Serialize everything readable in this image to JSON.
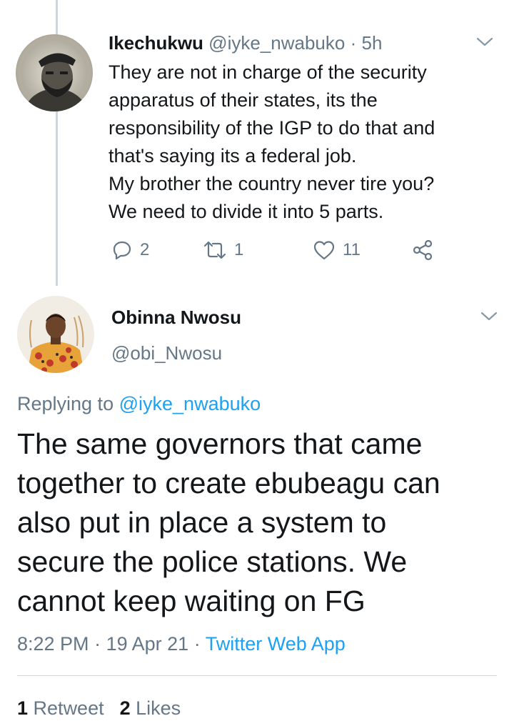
{
  "parent_tweet": {
    "name": "Ikechukwu",
    "handle": "@iyke_nwabuko",
    "separator": "·",
    "time": "5h",
    "text_lines": [
      "They are not in charge of the security",
      "apparatus of their states, its the",
      "responsibility of the IGP to do that and",
      "that's saying its a federal job.",
      "My brother the country never tire you?",
      "We need to divide it into 5 parts."
    ],
    "actions": {
      "replies": "2",
      "retweets": "1",
      "likes": "11"
    },
    "avatar_icon": "user-avatar-icon",
    "menu_icon": "chevron-down-icon"
  },
  "main_tweet": {
    "name": "Obinna Nwosu",
    "handle": "@obi_Nwosu",
    "replying_prefix": "Replying to",
    "replying_mention": "@iyke_nwabuko",
    "text_lines": [
      "The same governors that came",
      "together to create ebubeagu can",
      "also put in place a system to",
      "secure the police stations. We",
      "cannot keep waiting on FG"
    ],
    "time": "8:22 PM",
    "sep1": "·",
    "date": "19 Apr 21",
    "sep2": "·",
    "source": "Twitter Web App",
    "stats": {
      "retweet_count": "1",
      "retweet_label": "Retweet",
      "like_count": "2",
      "like_label": "Likes"
    },
    "avatar_icon": "user-avatar-icon",
    "menu_icon": "chevron-down-icon"
  },
  "colors": {
    "text": "#14171a",
    "secondary": "#657786",
    "link": "#1da1f2",
    "divider": "#ccd6dd"
  }
}
